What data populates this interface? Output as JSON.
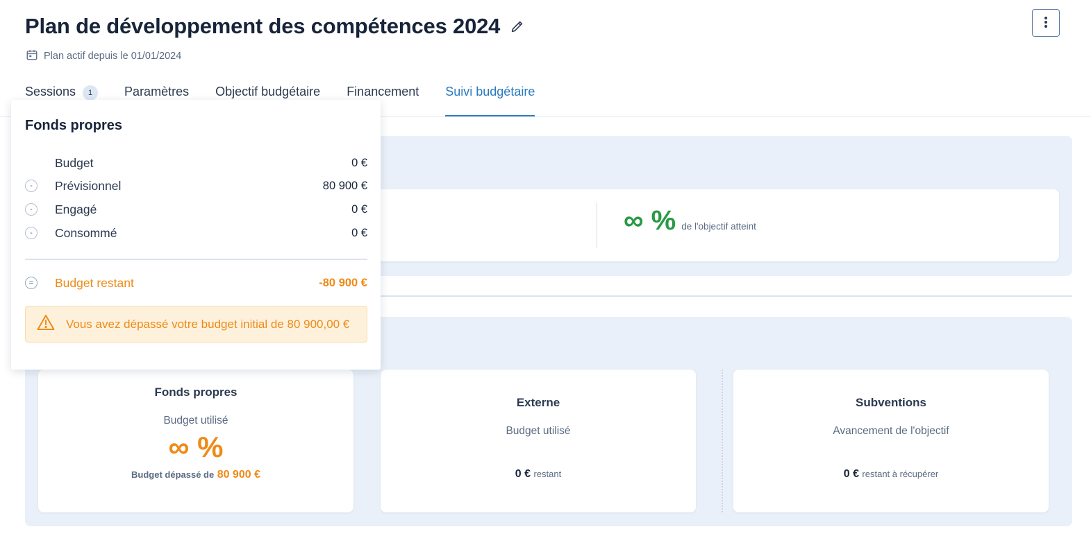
{
  "header": {
    "title": "Plan de développement des compétences 2024",
    "subtitle": "Plan actif depuis le 01/01/2024"
  },
  "tabs": [
    {
      "label": "Sessions",
      "badge": "1"
    },
    {
      "label": "Paramètres"
    },
    {
      "label": "Objectif budgétaire"
    },
    {
      "label": "Financement"
    },
    {
      "label": "Suivi budgétaire",
      "active": true
    }
  ],
  "objective": {
    "value": "∞ %",
    "label": "de l'objectif atteint"
  },
  "funding_cards": [
    {
      "title": "Fonds propres",
      "subtitle": "Budget utilisé",
      "value": "∞ %",
      "note_prefix": "Budget dépassé de",
      "note_amount": "80 900 €"
    },
    {
      "title": "Externe",
      "subtitle": "Budget utilisé",
      "amount": "0 €",
      "amount_note": "restant"
    },
    {
      "title": "Subventions",
      "subtitle": "Avancement de l'objectif",
      "amount": "0 €",
      "amount_note": "restant à récupérer"
    }
  ],
  "popover": {
    "title": "Fonds propres",
    "rows": [
      {
        "symbol": "",
        "label": "Budget",
        "value": "0 €"
      },
      {
        "symbol": "-",
        "label": "Prévisionnel",
        "value": "80 900 €"
      },
      {
        "symbol": "-",
        "label": "Engagé",
        "value": "0 €"
      },
      {
        "symbol": "-",
        "label": "Consommé",
        "value": "0 €"
      }
    ],
    "remaining": {
      "symbol": "=",
      "label": "Budget restant",
      "value": "-80 900 €"
    },
    "warning": "Vous avez dépassé votre budget initial de 80 900,00 €"
  },
  "colors": {
    "accent": "#2a7abf",
    "success": "#2a9a45",
    "warning": "#ef8a17",
    "panel_bg": "#eaf0f9"
  }
}
